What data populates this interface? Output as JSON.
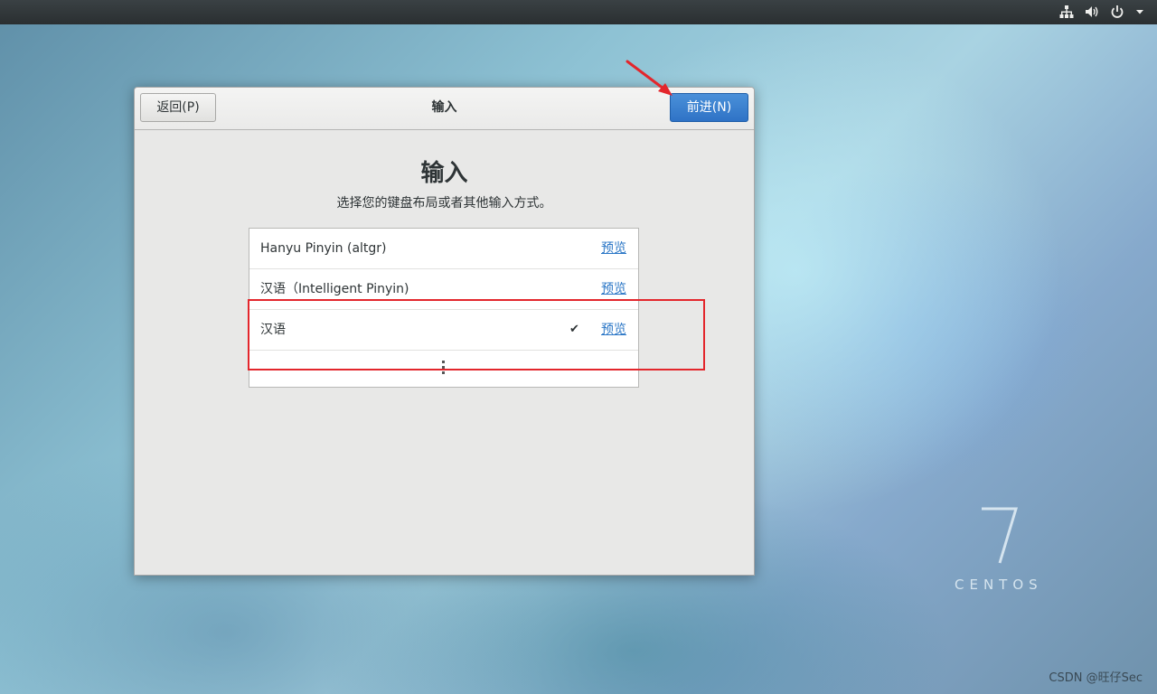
{
  "topbar": {
    "icons": [
      "network-icon",
      "volume-icon",
      "power-icon",
      "chevron-down-icon"
    ]
  },
  "window": {
    "title": "输入",
    "back_label": "返回(P)",
    "next_label": "前进(N)"
  },
  "page": {
    "heading": "输入",
    "subtitle": "选择您的键盘布局或者其他输入方式。"
  },
  "input_sources": [
    {
      "name": "Hanyu Pinyin (altgr)",
      "preview": "预览",
      "selected": false
    },
    {
      "name": "汉语（Intelligent Pinyin)",
      "preview": "预览",
      "selected": false
    },
    {
      "name": "汉语",
      "preview": "预览",
      "selected": true,
      "check": "✔"
    }
  ],
  "more_icon": "more-vertical-icon",
  "desktop": {
    "brand": "CENTOS",
    "watermark": "CSDN @旺仔Sec"
  },
  "colors": {
    "accent": "#2f73c6",
    "annotation": "#e3262c",
    "link": "#2a76c6"
  }
}
